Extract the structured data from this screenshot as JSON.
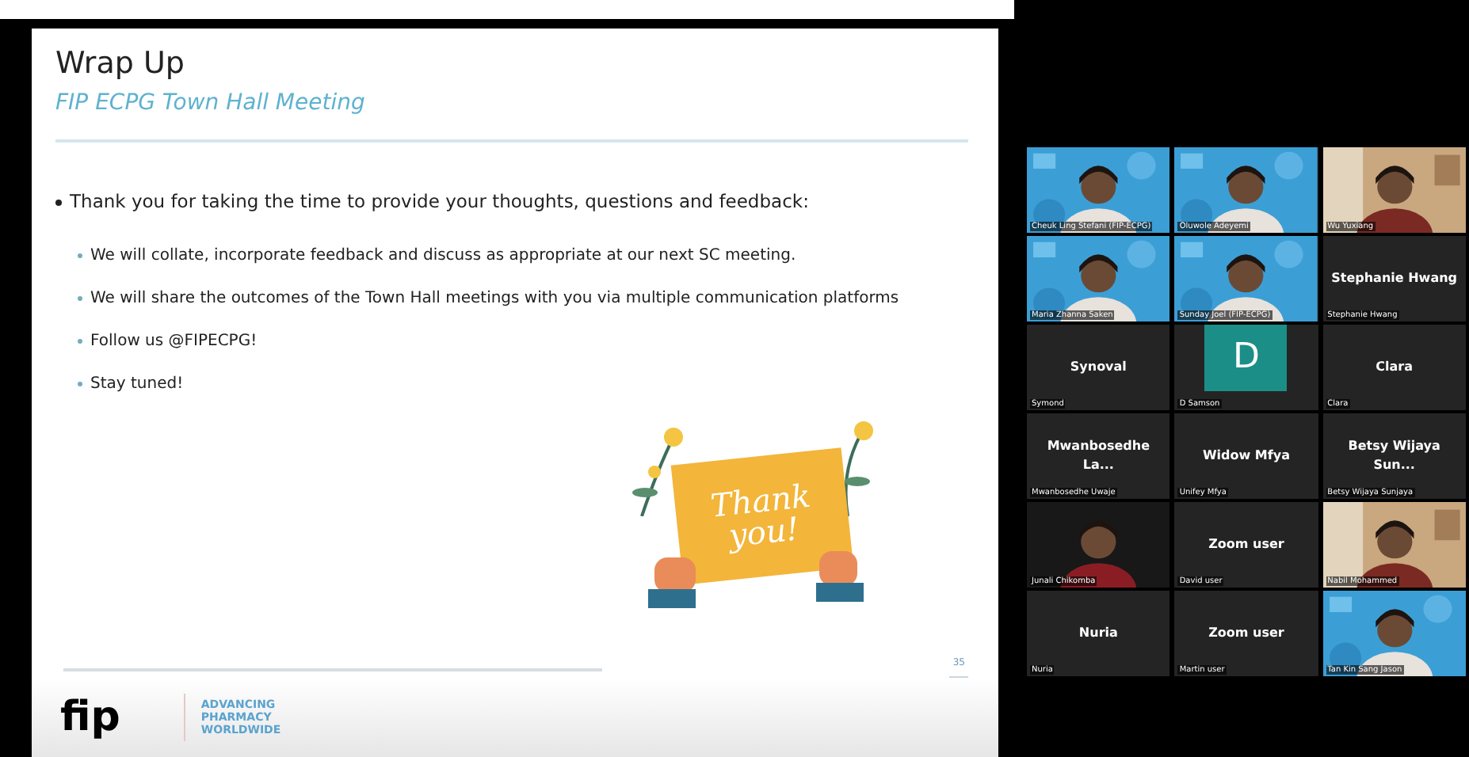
{
  "slide": {
    "title": "Wrap Up",
    "subtitle": "FIP ECPG Town Hall Meeting",
    "bullets": [
      {
        "text": "Thank you for taking the time to provide your thoughts, questions and feedback:",
        "children": [
          {
            "text": "We will collate, incorporate feedback and discuss as appropriate at our next SC meeting."
          },
          {
            "text": "We will share the outcomes of the Town Hall meetings with you via multiple communication platforms"
          },
          {
            "text": "Follow us @FIPECPG!"
          },
          {
            "text": "Stay tuned!"
          }
        ]
      }
    ],
    "card_text": "Thank you!",
    "page_number": "35",
    "logo": "fip",
    "tagline": [
      "ADVANCING",
      "PHARMACY",
      "WORLDWIDE"
    ]
  },
  "gallery": [
    {
      "kind": "video",
      "label": "Cheuk Ling Stefani (FIP-ECPG)"
    },
    {
      "kind": "video",
      "label": "Oluwole Adeyemi"
    },
    {
      "kind": "video",
      "label": "Wu Yuxiang"
    },
    {
      "kind": "video",
      "label": "Maria Zhanna Saken"
    },
    {
      "kind": "video",
      "label": "Sunday Joel (FIP-ECPG)"
    },
    {
      "kind": "name",
      "name": "Stephanie Hwang",
      "label": "Stephanie Hwang"
    },
    {
      "kind": "name",
      "name": "Synoval",
      "label": "Symond"
    },
    {
      "kind": "avatar",
      "initial": "D",
      "label": "D Samson"
    },
    {
      "kind": "name",
      "name": "Clara",
      "label": "Clara"
    },
    {
      "kind": "name",
      "name": "Mwanbosedhe La...",
      "label": "Mwanbosedhe Uwaje"
    },
    {
      "kind": "name",
      "name": "Widow Mfya",
      "label": "Unifey Mfya"
    },
    {
      "kind": "name",
      "name": "Betsy Wijaya Sun...",
      "label": "Betsy Wijaya Sunjaya"
    },
    {
      "kind": "video",
      "label": "Junali Chikomba"
    },
    {
      "kind": "name",
      "name": "Zoom user",
      "label": "David user"
    },
    {
      "kind": "video",
      "label": "Nabil Mohammed"
    },
    {
      "kind": "name",
      "name": "Nuria",
      "label": "Nuria"
    },
    {
      "kind": "name",
      "name": "Zoom user",
      "label": "Martin user"
    },
    {
      "kind": "video",
      "label": "Tan Kin Sang Jason"
    }
  ]
}
